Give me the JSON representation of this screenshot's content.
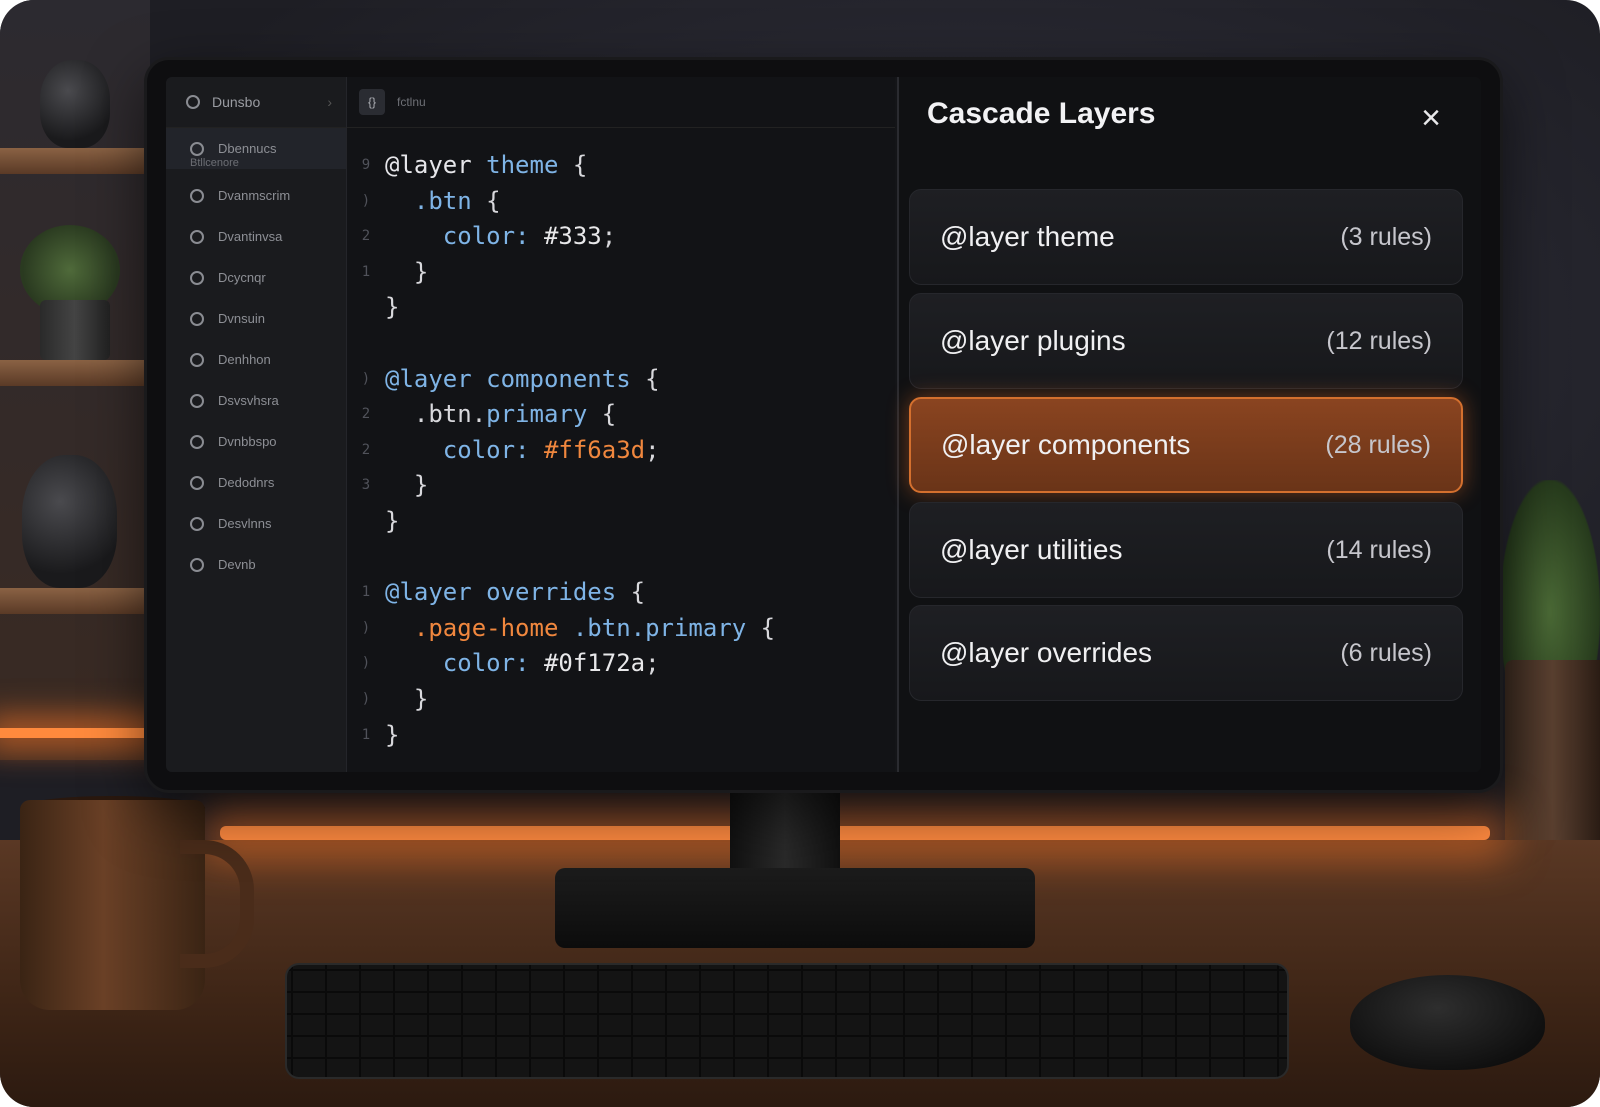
{
  "sidebar": {
    "header_label": "Dunsbo",
    "items": [
      {
        "label": "Dbennucs",
        "sub": "Btllcenore"
      },
      {
        "label": "Dvanmscrim"
      },
      {
        "label": "Dvantinvsa"
      },
      {
        "label": "Dcycnqr"
      },
      {
        "label": "Dvnsuin"
      },
      {
        "label": "Denhhon"
      },
      {
        "label": "Dsvsvhsra"
      },
      {
        "label": "Dvnbbspo"
      },
      {
        "label": "Dedodnrs"
      },
      {
        "label": "Desvlnns"
      },
      {
        "label": "Devnb"
      }
    ]
  },
  "editor": {
    "tab_icon": "{}",
    "tab_label": "fctlnu"
  },
  "code": [
    {
      "ln": "9",
      "tokens": [
        {
          "t": "@layer ",
          "c": "kw"
        },
        {
          "t": "theme",
          "c": "blue"
        },
        {
          "t": " {",
          "c": "punc"
        }
      ]
    },
    {
      "ln": ")",
      "tokens": [
        {
          "t": "  .btn",
          "c": "blue"
        },
        {
          "t": " {",
          "c": "punc"
        }
      ]
    },
    {
      "ln": "2",
      "tokens": [
        {
          "t": "    color: ",
          "c": "blue"
        },
        {
          "t": "#333",
          "c": "white"
        },
        {
          "t": ";",
          "c": "punc"
        }
      ]
    },
    {
      "ln": "1",
      "tokens": [
        {
          "t": "  }",
          "c": "punc"
        }
      ]
    },
    {
      "ln": "",
      "tokens": [
        {
          "t": "}",
          "c": "punc"
        }
      ]
    },
    {
      "ln": "",
      "tokens": []
    },
    {
      "ln": ")",
      "tokens": [
        {
          "t": "@layer ",
          "c": "blue"
        },
        {
          "t": "components",
          "c": "blue"
        },
        {
          "t": " {",
          "c": "punc"
        }
      ]
    },
    {
      "ln": "2",
      "tokens": [
        {
          "t": "  .btn.",
          "c": "punc"
        },
        {
          "t": "primary",
          "c": "blue"
        },
        {
          "t": " {",
          "c": "punc"
        }
      ]
    },
    {
      "ln": "2",
      "tokens": [
        {
          "t": "    color: ",
          "c": "blue"
        },
        {
          "t": "#ff6a3d",
          "c": "orange"
        },
        {
          "t": ";",
          "c": "punc"
        }
      ]
    },
    {
      "ln": "3",
      "tokens": [
        {
          "t": "  }",
          "c": "punc"
        }
      ]
    },
    {
      "ln": "",
      "tokens": [
        {
          "t": "}",
          "c": "punc"
        }
      ]
    },
    {
      "ln": "",
      "tokens": []
    },
    {
      "ln": "1",
      "tokens": [
        {
          "t": "@layer ",
          "c": "blue"
        },
        {
          "t": "overrides",
          "c": "blue"
        },
        {
          "t": " {",
          "c": "punc"
        }
      ]
    },
    {
      "ln": ")",
      "tokens": [
        {
          "t": "  .page-home",
          "c": "orange"
        },
        {
          "t": " .btn.primary",
          "c": "blue"
        },
        {
          "t": " {",
          "c": "punc"
        }
      ]
    },
    {
      "ln": ")",
      "tokens": [
        {
          "t": "    color: ",
          "c": "blue"
        },
        {
          "t": "#0f172a",
          "c": "white"
        },
        {
          "t": ";",
          "c": "punc"
        }
      ]
    },
    {
      "ln": ")",
      "tokens": [
        {
          "t": "  }",
          "c": "punc"
        }
      ]
    },
    {
      "ln": "1",
      "tokens": [
        {
          "t": "}",
          "c": "punc"
        }
      ]
    }
  ],
  "panel": {
    "title": "Cascade Layers",
    "close_icon": "close-icon",
    "layers": [
      {
        "name": "@layer theme",
        "count": "(3 rules)",
        "active": false
      },
      {
        "name": "@layer plugins",
        "count": "(12 rules)",
        "active": false
      },
      {
        "name": "@layer components",
        "count": "(28 rules)",
        "active": true
      },
      {
        "name": "@layer utilities",
        "count": "(14 rules)",
        "active": false
      },
      {
        "name": "@layer overrides",
        "count": "(6 rules)",
        "active": false
      }
    ]
  },
  "colors": {
    "accent": "#d4702e",
    "active_row": "#7a3c1c",
    "code_blue": "#7fb4e6",
    "code_orange": "#f0873e"
  }
}
